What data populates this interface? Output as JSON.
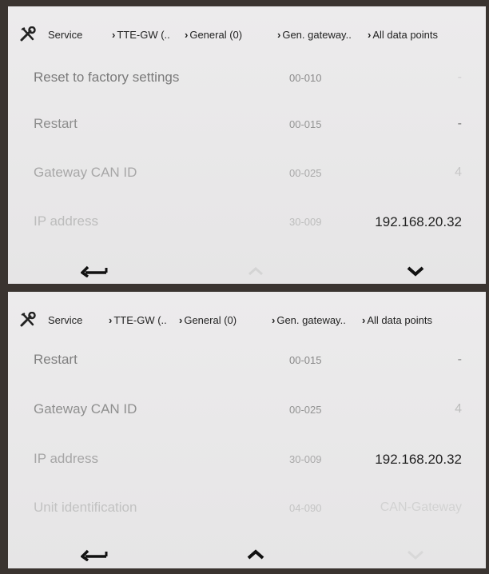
{
  "breadcrumb": {
    "service": "Service",
    "device": "TTE-GW (..",
    "general": "General (0)",
    "gateway": "Gen. gateway..",
    "all": "All data points"
  },
  "screen1": {
    "rows": [
      {
        "label": "Reset to factory settings",
        "code": "00-010",
        "value": "-"
      },
      {
        "label": "Restart",
        "code": "00-015",
        "value": "-"
      },
      {
        "label": "Gateway CAN ID",
        "code": "00-025",
        "value": "4"
      },
      {
        "label": "IP address",
        "code": "30-009",
        "value": "192.168.20.32"
      }
    ]
  },
  "screen2": {
    "rows": [
      {
        "label": "Restart",
        "code": "00-015",
        "value": "-"
      },
      {
        "label": "Gateway CAN ID",
        "code": "00-025",
        "value": "4"
      },
      {
        "label": "IP address",
        "code": "30-009",
        "value": "192.168.20.32"
      },
      {
        "label": "Unit identification",
        "code": "04-090",
        "value": "CAN-Gateway"
      }
    ]
  },
  "icons": {
    "tools": "tools-icon",
    "crumb_arrow": "chevron-right-icon",
    "back": "back-arrow-icon",
    "up": "chevron-up-icon",
    "down": "chevron-down-icon"
  }
}
